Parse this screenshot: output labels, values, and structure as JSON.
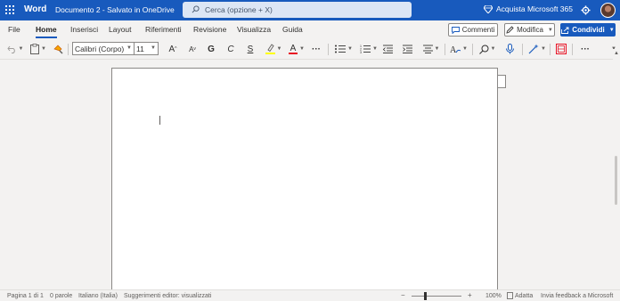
{
  "titlebar": {
    "app_name": "Word",
    "doc_title": "Documento 2  -  Salvato in OneDrive",
    "search_placeholder": "Cerca (opzione + X)",
    "buy_label": "Acquista Microsoft 365",
    "settings_icon": "gear-icon",
    "brand_color": "#185abd"
  },
  "tabs": [
    {
      "label": "File"
    },
    {
      "label": "Home",
      "active": true
    },
    {
      "label": "Inserisci"
    },
    {
      "label": "Layout"
    },
    {
      "label": "Riferimenti"
    },
    {
      "label": "Revisione"
    },
    {
      "label": "Visualizza"
    },
    {
      "label": "Guida"
    }
  ],
  "actions": {
    "comments_label": "Commenti",
    "edit_label": "Modifica",
    "share_label": "Condividi"
  },
  "ribbon": {
    "font_name": "Calibri (Corpo)",
    "font_size": "11",
    "bold": "G",
    "italic": "C",
    "underline": "S",
    "grow_font": "A",
    "shrink_font": "A",
    "font_color_letter": "A",
    "more": "···",
    "highlight_color": "#ffff00",
    "font_color": "#e81123"
  },
  "statusbar": {
    "page": "Pagina 1 di 1",
    "words": "0 parole",
    "language": "Italiano (Italia)",
    "editor": "Suggerimenti editor: visualizzati",
    "zoom_minus": "−",
    "zoom_plus": "+",
    "zoom": "100%",
    "fit": "Adatta",
    "feedback": "Invia feedback a Microsoft",
    "zoom_level": 1.0
  }
}
